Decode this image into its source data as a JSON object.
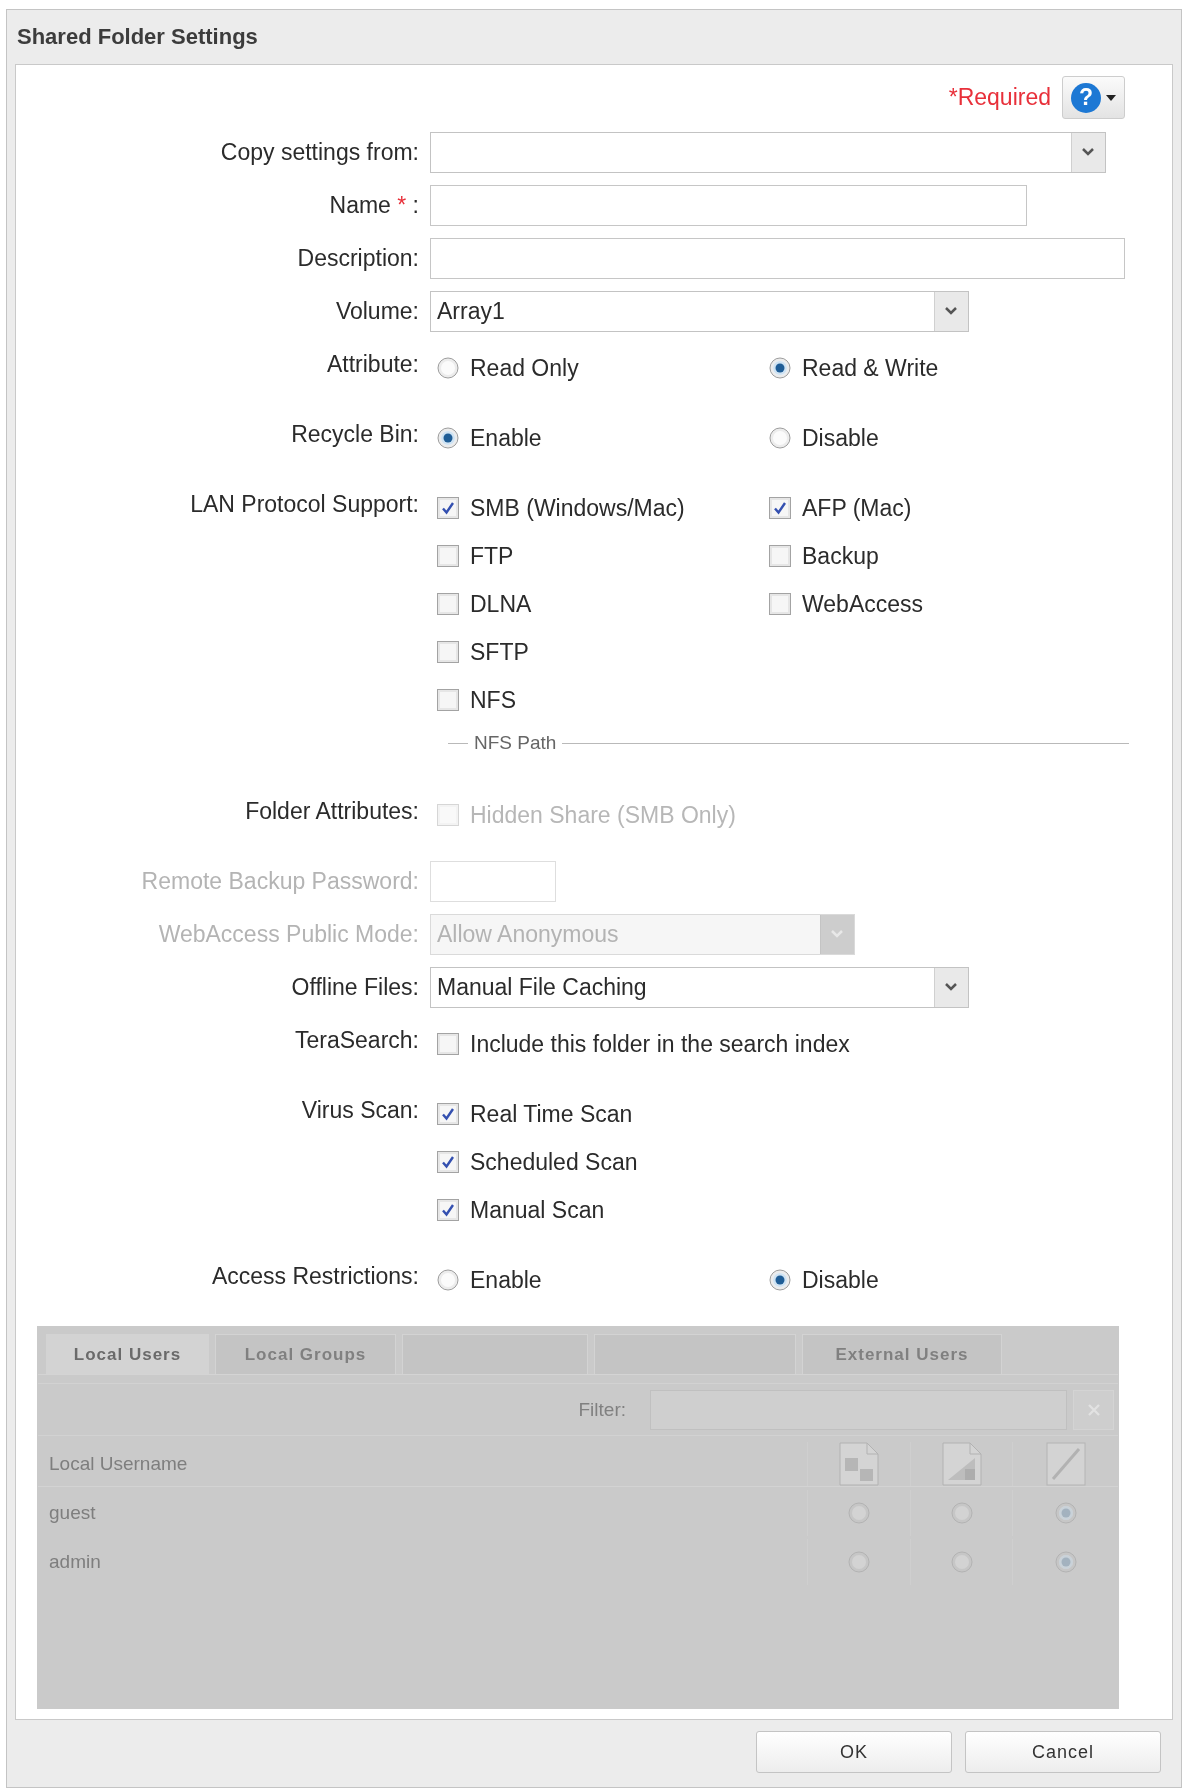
{
  "window": {
    "title": "Shared Folder Settings"
  },
  "required_note": "*Required",
  "help_button": {
    "symbol": "?"
  },
  "fields": [
    {
      "kind": "select",
      "label": "Copy settings from:",
      "disabled": false
    },
    {
      "kind": "text",
      "label": "Name",
      "required_mark": "*",
      "label_suffix": ":",
      "disabled": false
    },
    {
      "kind": "text",
      "label": "Description:",
      "disabled": false
    },
    {
      "kind": "select",
      "label": "Volume:",
      "value": "Array1",
      "disabled": false
    },
    {
      "kind": "radio",
      "label": "Attribute:",
      "disabled": false,
      "rows": [
        [
          {
            "label": "Read Only",
            "selected": false
          },
          {
            "label": "Read & Write",
            "selected": true
          }
        ]
      ]
    },
    {
      "kind": "radio",
      "label": "Recycle Bin:",
      "disabled": false,
      "rows": [
        [
          {
            "label": "Enable",
            "selected": true
          },
          {
            "label": "Disable",
            "selected": false
          }
        ]
      ]
    },
    {
      "kind": "checkbox",
      "label": "LAN Protocol Support:",
      "disabled": false,
      "rows": [
        [
          {
            "label": "SMB (Windows/Mac)",
            "checked": true
          },
          {
            "label": "AFP (Mac)",
            "checked": true
          }
        ],
        [
          {
            "label": "FTP",
            "checked": false
          },
          {
            "label": "Backup",
            "checked": false
          }
        ],
        [
          {
            "label": "DLNA",
            "checked": false
          },
          {
            "label": "WebAccess",
            "checked": false
          }
        ],
        [
          {
            "label": "SFTP",
            "checked": false
          }
        ],
        [
          {
            "label": "NFS",
            "checked": false
          }
        ]
      ],
      "section": {
        "legend": "NFS Path"
      }
    },
    {
      "kind": "checkbox",
      "label": "Folder Attributes:",
      "disabled": false,
      "rows": [
        [
          {
            "label": "Hidden Share (SMB Only)",
            "checked": false,
            "disabled": true
          }
        ]
      ]
    },
    {
      "kind": "password",
      "label": "Remote Backup Password:",
      "disabled": true
    },
    {
      "kind": "select",
      "label": "WebAccess Public Mode:",
      "value": "Allow Anonymous",
      "disabled": true
    },
    {
      "kind": "select",
      "label": "Offline Files:",
      "value": "Manual File Caching",
      "disabled": false
    },
    {
      "kind": "checkbox",
      "label": "TeraSearch:",
      "disabled": false,
      "rows": [
        [
          {
            "label": "Include this folder in the search index",
            "checked": false
          }
        ]
      ]
    },
    {
      "kind": "checkbox",
      "label": "Virus Scan:",
      "disabled": false,
      "rows": [
        [
          {
            "label": "Real Time Scan",
            "checked": true
          }
        ],
        [
          {
            "label": "Scheduled Scan",
            "checked": true
          }
        ],
        [
          {
            "label": "Manual Scan",
            "checked": true
          }
        ]
      ]
    },
    {
      "kind": "radio",
      "label": "Access Restrictions:",
      "disabled": false,
      "rows": [
        [
          {
            "label": "Enable",
            "selected": false
          },
          {
            "label": "Disable",
            "selected": true
          }
        ]
      ]
    }
  ],
  "access_table": {
    "disabled": true,
    "tabs": [
      {
        "label": "Local Users",
        "selected": true
      },
      {
        "label": "Local Groups",
        "selected": false
      },
      {
        "selected": false
      },
      {
        "selected": false
      },
      {
        "label": "External Users",
        "selected": false
      }
    ],
    "filter_label": "Filter:",
    "columns": [
      {
        "kind": "text",
        "label": "Local Username"
      },
      {
        "kind": "rw"
      },
      {
        "kind": "r"
      },
      {
        "kind": "deny"
      }
    ],
    "rows": [
      {
        "name": "guest",
        "options": [
          {
            "selected": false
          },
          {
            "selected": false
          },
          {
            "selected": true
          }
        ]
      },
      {
        "name": "admin",
        "options": [
          {
            "selected": false
          },
          {
            "selected": false
          },
          {
            "selected": true
          }
        ]
      }
    ]
  },
  "buttons": [
    "OK",
    "Cancel"
  ]
}
